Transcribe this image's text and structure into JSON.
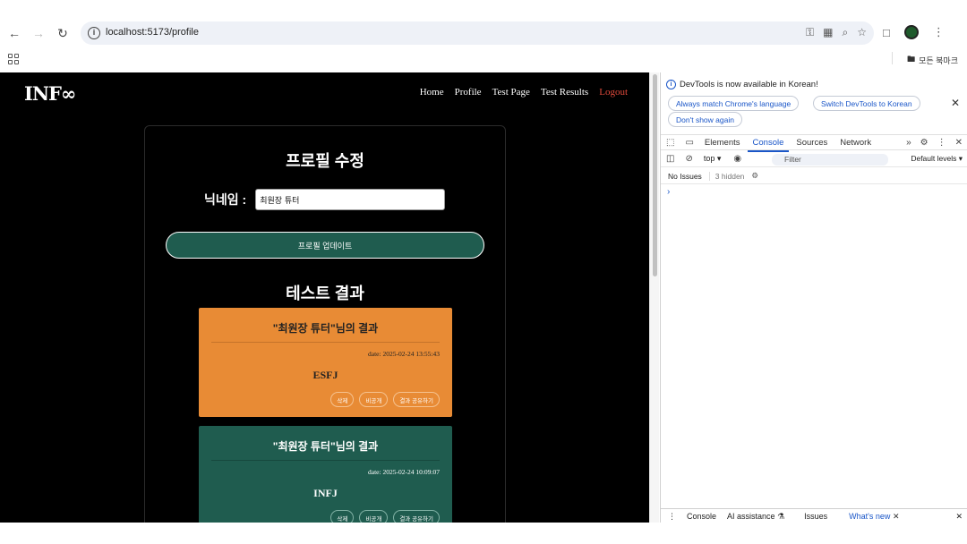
{
  "browser": {
    "url": "localhost:5173/profile",
    "bookmark_folder": "모든 북마크"
  },
  "site": {
    "logo": "INF∞",
    "nav": [
      "Home",
      "Profile",
      "Test Page",
      "Test Results"
    ],
    "logout": "Logout"
  },
  "profile": {
    "title": "프로필 수정",
    "nickname_label": "닉네임 :",
    "nickname_value": "최원장 튜터",
    "update_button": "프로필 업데이트",
    "results_title": "테스트 결과"
  },
  "results": [
    {
      "title": "\"최원장 튜터\"님의 결과",
      "date": "date: 2025-02-24 13:55:43",
      "type": "ESFJ",
      "buttons": [
        "삭제",
        "비공개",
        "결과 공유하기"
      ],
      "color": "#e88b35"
    },
    {
      "title": "\"최원장 튜터\"님의 결과",
      "date": "date: 2025-02-24 10:09:07",
      "type": "INFJ",
      "buttons": [
        "삭제",
        "비공개",
        "결과 공유하기"
      ],
      "color": "#1f5c4f"
    }
  ],
  "devtools": {
    "banner": "DevTools is now available in Korean!",
    "btn_match": "Always match Chrome's language",
    "btn_switch": "Switch DevTools to Korean",
    "btn_dont": "Don't show again",
    "tabs": [
      "Elements",
      "Console",
      "Sources",
      "Network"
    ],
    "context": "top",
    "filter_placeholder": "Filter",
    "levels": "Default levels",
    "no_issues": "No Issues",
    "hidden": "3 hidden",
    "drawer_tabs": [
      "Console",
      "AI assistance",
      "Issues"
    ],
    "whats_new": "What's new"
  }
}
